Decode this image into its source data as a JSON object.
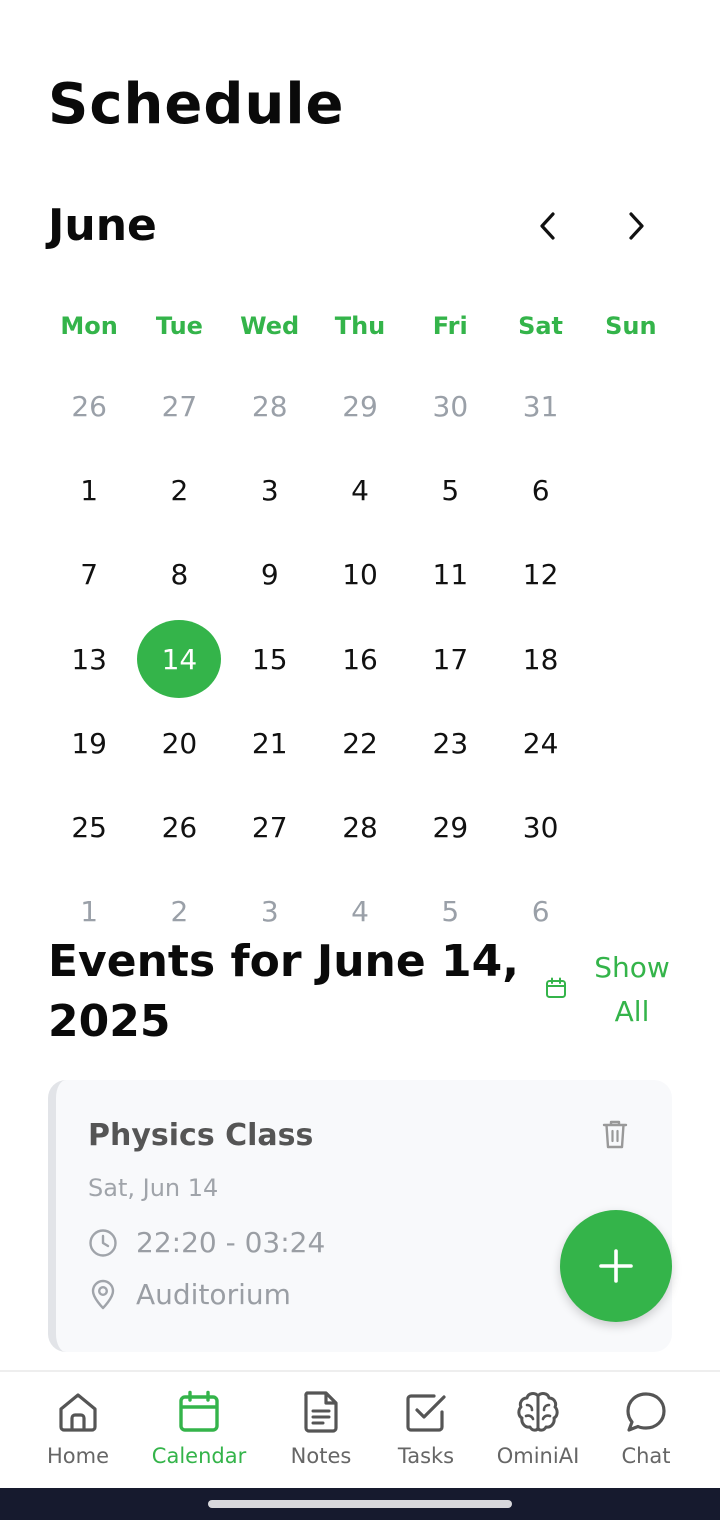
{
  "header": {
    "title": "Schedule"
  },
  "calendar": {
    "month": "June",
    "weekdays": [
      "Mon",
      "Tue",
      "Wed",
      "Thu",
      "Fri",
      "Sat",
      "Sun"
    ],
    "days": [
      {
        "label": "26",
        "muted": true
      },
      {
        "label": "27",
        "muted": true
      },
      {
        "label": "28",
        "muted": true
      },
      {
        "label": "29",
        "muted": true
      },
      {
        "label": "30",
        "muted": true
      },
      {
        "label": "31",
        "muted": true
      },
      {
        "label": "1"
      },
      {
        "label": "2"
      },
      {
        "label": "3"
      },
      {
        "label": "4"
      },
      {
        "label": "5"
      },
      {
        "label": "6"
      },
      {
        "label": "7"
      },
      {
        "label": "8"
      },
      {
        "label": "9"
      },
      {
        "label": "10"
      },
      {
        "label": "11"
      },
      {
        "label": "12"
      },
      {
        "label": "13"
      },
      {
        "label": "14",
        "selected": true
      },
      {
        "label": "15"
      },
      {
        "label": "16"
      },
      {
        "label": "17"
      },
      {
        "label": "18"
      },
      {
        "label": "19"
      },
      {
        "label": "20"
      },
      {
        "label": "21"
      },
      {
        "label": "22"
      },
      {
        "label": "23"
      },
      {
        "label": "24"
      },
      {
        "label": "25"
      },
      {
        "label": "26"
      },
      {
        "label": "27"
      },
      {
        "label": "28"
      },
      {
        "label": "29"
      },
      {
        "label": "30"
      },
      {
        "label": "1",
        "muted": true
      },
      {
        "label": "2",
        "muted": true
      },
      {
        "label": "3",
        "muted": true
      },
      {
        "label": "4",
        "muted": true
      },
      {
        "label": "5",
        "muted": true
      },
      {
        "label": "6",
        "muted": true
      }
    ]
  },
  "events": {
    "heading": "Events for June 14, 2025",
    "show_all_label": "Show All",
    "items": [
      {
        "title": "Physics Class",
        "date": "Sat, Jun 14",
        "time": "22:20 - 03:24",
        "location": "Auditorium"
      }
    ]
  },
  "bottom_nav": {
    "items": [
      {
        "label": "Home",
        "icon": "home-icon"
      },
      {
        "label": "Calendar",
        "icon": "calendar-icon",
        "active": true
      },
      {
        "label": "Notes",
        "icon": "notes-icon"
      },
      {
        "label": "Tasks",
        "icon": "tasks-icon"
      },
      {
        "label": "OminiAI",
        "icon": "brain-icon"
      },
      {
        "label": "Chat",
        "icon": "chat-icon"
      }
    ]
  },
  "colors": {
    "accent": "#34b44a",
    "muted_text": "#9aa0a8",
    "system_bar": "#161a2e"
  }
}
